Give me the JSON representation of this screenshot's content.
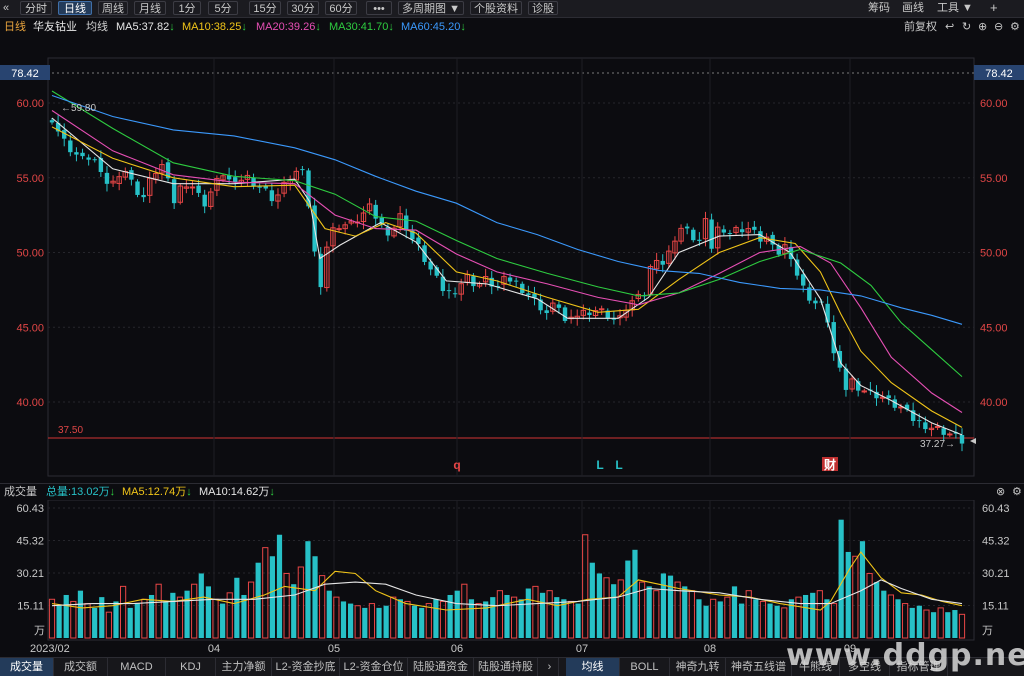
{
  "toolbar": {
    "back_icon": "double-chevron-left-icon",
    "items": [
      "分时",
      "日线",
      "周线",
      "月线",
      "1分",
      "5分",
      "15分",
      "30分",
      "60分",
      "•••",
      "多周期图 ▼",
      "个股资料",
      "诊股"
    ],
    "active": 1,
    "right": [
      "筹码",
      "画线",
      "工具 ▼",
      "+"
    ]
  },
  "header": {
    "period": "日线",
    "name": "华友钴业",
    "ma_label": "均线",
    "ma": [
      {
        "text": "MA5:37.82",
        "color": "#e6e6e6"
      },
      {
        "text": "MA10:38.25",
        "color": "#f0c419"
      },
      {
        "text": "MA20:39.26",
        "color": "#e64fb4"
      },
      {
        "text": "MA30:41.70",
        "color": "#2ecc40"
      },
      {
        "text": "MA60:45.20",
        "color": "#3b99fc"
      }
    ],
    "adjust": "前复权"
  },
  "price_axis": {
    "ticks": [
      "60.00",
      "55.00",
      "50.00",
      "45.00",
      "40.00"
    ],
    "tick_values": [
      60,
      55,
      50,
      45,
      40
    ],
    "top_marker": "78.42",
    "high_label": "59.80",
    "low_line": "37.50",
    "low_label": "37.27→"
  },
  "markers": [
    "q",
    "L",
    "L",
    "财"
  ],
  "volume": {
    "title": "成交量",
    "total": "总量:13.02万",
    "ma5": "MA5:12.74万",
    "ma10": "MA10:14.62万",
    "ticks": [
      "60.43",
      "45.32",
      "30.21",
      "15.11"
    ],
    "unit": "万",
    "max": 60.43
  },
  "dates": [
    "2023/02",
    "04",
    "05",
    "06",
    "07",
    "08",
    "09"
  ],
  "bottom_tabs": [
    "成交量",
    "成交额",
    "MACD",
    "KDJ",
    "主力净额",
    "L2-资金抄底",
    "L2-资金仓位",
    "陆股通资金",
    "陆股通持股"
  ],
  "indicator_tabs": [
    "均线",
    "BOLL",
    "神奇九转",
    "神奇五线谱",
    "牛熊线",
    "多空线",
    "指标管理"
  ],
  "watermark": "www.ddgp.net",
  "chart_data": {
    "type": "candlestick",
    "title": "华友钴业 日线",
    "xlabel": "",
    "ylabel": "",
    "ylim": [
      37.0,
      61.5
    ],
    "period_labels": [
      "2023/02",
      "04",
      "05",
      "06",
      "07",
      "08",
      "09"
    ],
    "close_path": [
      [
        0,
        59.0
      ],
      [
        10,
        57.6
      ],
      [
        20,
        56.8
      ],
      [
        30,
        56.2
      ],
      [
        40,
        56.5
      ],
      [
        50,
        54.8
      ],
      [
        60,
        54.6
      ],
      [
        70,
        55.8
      ],
      [
        80,
        54.5
      ],
      [
        90,
        53.6
      ],
      [
        100,
        55.3
      ],
      [
        110,
        55.9
      ],
      [
        120,
        53.3
      ],
      [
        130,
        54.8
      ],
      [
        140,
        54.4
      ],
      [
        150,
        53.2
      ],
      [
        160,
        54.4
      ],
      [
        170,
        55.4
      ],
      [
        180,
        54.3
      ],
      [
        190,
        55.2
      ],
      [
        200,
        54.7
      ],
      [
        210,
        54.2
      ],
      [
        220,
        53.5
      ],
      [
        230,
        54.5
      ],
      [
        240,
        55.4
      ],
      [
        250,
        55.2
      ],
      [
        260,
        49.8
      ],
      [
        265,
        47.6
      ],
      [
        270,
        50.1
      ],
      [
        278,
        51.5
      ],
      [
        285,
        51.9
      ],
      [
        295,
        51.8
      ],
      [
        305,
        52.4
      ],
      [
        315,
        53.0
      ],
      [
        325,
        51.8
      ],
      [
        335,
        51.3
      ],
      [
        345,
        52.5
      ],
      [
        355,
        51.0
      ],
      [
        365,
        50.1
      ],
      [
        370,
        49.3
      ],
      [
        380,
        48.2
      ],
      [
        390,
        47.2
      ],
      [
        400,
        47.6
      ],
      [
        410,
        48.4
      ],
      [
        420,
        47.8
      ],
      [
        430,
        48.2
      ],
      [
        440,
        47.6
      ],
      [
        450,
        48.3
      ],
      [
        460,
        47.9
      ],
      [
        470,
        47.3
      ],
      [
        480,
        46.6
      ],
      [
        490,
        45.9
      ],
      [
        500,
        46.8
      ],
      [
        505,
        45.6
      ],
      [
        510,
        45.1
      ],
      [
        520,
        45.9
      ],
      [
        530,
        46.1
      ],
      [
        540,
        46.2
      ],
      [
        550,
        45.8
      ],
      [
        560,
        45.3
      ],
      [
        570,
        46.6
      ],
      [
        580,
        46.9
      ],
      [
        590,
        47.5
      ],
      [
        595,
        51.2
      ],
      [
        600,
        48.8
      ],
      [
        610,
        49.9
      ],
      [
        620,
        51.7
      ],
      [
        630,
        51.3
      ],
      [
        640,
        50.6
      ],
      [
        645,
        52.7
      ],
      [
        650,
        49.9
      ],
      [
        660,
        51.9
      ],
      [
        670,
        51.3
      ],
      [
        680,
        51.6
      ],
      [
        690,
        51.6
      ],
      [
        700,
        50.9
      ],
      [
        710,
        51.0
      ],
      [
        715,
        49.6
      ],
      [
        720,
        50.1
      ],
      [
        728,
        50.6
      ],
      [
        735,
        48.8
      ],
      [
        745,
        47.3
      ],
      [
        755,
        46.6
      ],
      [
        765,
        46.3
      ],
      [
        775,
        42.5
      ],
      [
        780,
        41.9
      ],
      [
        785,
        40.9
      ],
      [
        790,
        41.5
      ],
      [
        800,
        40.9
      ],
      [
        810,
        40.6
      ],
      [
        820,
        40.4
      ],
      [
        830,
        39.9
      ],
      [
        840,
        39.6
      ],
      [
        850,
        38.9
      ],
      [
        860,
        38.6
      ],
      [
        870,
        38.3
      ],
      [
        880,
        38.1
      ],
      [
        890,
        37.8
      ],
      [
        900,
        37.4
      ]
    ],
    "series": [
      {
        "name": "MA5",
        "color": "#e6e6e6",
        "values": [
          [
            0,
            59.0
          ],
          [
            60,
            55.6
          ],
          [
            120,
            54.6
          ],
          [
            180,
            54.6
          ],
          [
            240,
            54.9
          ],
          [
            255,
            53.4
          ],
          [
            265,
            49.6
          ],
          [
            285,
            50.5
          ],
          [
            325,
            52.0
          ],
          [
            360,
            50.7
          ],
          [
            390,
            48.1
          ],
          [
            430,
            47.9
          ],
          [
            480,
            46.9
          ],
          [
            510,
            45.6
          ],
          [
            560,
            45.6
          ],
          [
            590,
            47.0
          ],
          [
            620,
            50.0
          ],
          [
            660,
            51.1
          ],
          [
            700,
            51.2
          ],
          [
            730,
            50.0
          ],
          [
            760,
            46.9
          ],
          [
            780,
            42.6
          ],
          [
            800,
            41.1
          ],
          [
            830,
            40.1
          ],
          [
            870,
            38.6
          ],
          [
            900,
            37.8
          ]
        ]
      },
      {
        "name": "MA10",
        "color": "#f0c419",
        "values": [
          [
            0,
            58.4
          ],
          [
            60,
            56.3
          ],
          [
            120,
            55.0
          ],
          [
            180,
            54.4
          ],
          [
            240,
            54.5
          ],
          [
            270,
            51.6
          ],
          [
            300,
            51.1
          ],
          [
            330,
            52.0
          ],
          [
            360,
            51.3
          ],
          [
            400,
            48.7
          ],
          [
            440,
            48.1
          ],
          [
            490,
            47.0
          ],
          [
            540,
            46.0
          ],
          [
            580,
            46.2
          ],
          [
            620,
            48.2
          ],
          [
            660,
            50.0
          ],
          [
            700,
            51.0
          ],
          [
            735,
            50.6
          ],
          [
            760,
            48.7
          ],
          [
            780,
            45.9
          ],
          [
            800,
            43.4
          ],
          [
            830,
            41.3
          ],
          [
            870,
            39.4
          ],
          [
            900,
            38.3
          ]
        ]
      },
      {
        "name": "MA20",
        "color": "#e64fb4",
        "values": [
          [
            0,
            59.5
          ],
          [
            60,
            56.8
          ],
          [
            120,
            55.2
          ],
          [
            180,
            54.7
          ],
          [
            240,
            54.6
          ],
          [
            280,
            52.5
          ],
          [
            320,
            51.6
          ],
          [
            360,
            51.5
          ],
          [
            400,
            49.9
          ],
          [
            440,
            48.7
          ],
          [
            490,
            47.9
          ],
          [
            540,
            47.0
          ],
          [
            580,
            46.5
          ],
          [
            620,
            47.3
          ],
          [
            660,
            48.6
          ],
          [
            700,
            50.0
          ],
          [
            740,
            50.4
          ],
          [
            770,
            49.3
          ],
          [
            800,
            46.3
          ],
          [
            830,
            43.0
          ],
          [
            870,
            40.6
          ],
          [
            900,
            39.3
          ]
        ]
      },
      {
        "name": "MA30",
        "color": "#2ecc40",
        "values": [
          [
            0,
            60.8
          ],
          [
            60,
            58.3
          ],
          [
            120,
            56.0
          ],
          [
            180,
            55.1
          ],
          [
            240,
            54.8
          ],
          [
            280,
            53.9
          ],
          [
            320,
            52.4
          ],
          [
            360,
            52.1
          ],
          [
            400,
            50.8
          ],
          [
            440,
            49.6
          ],
          [
            490,
            48.6
          ],
          [
            540,
            47.7
          ],
          [
            580,
            47.1
          ],
          [
            620,
            47.3
          ],
          [
            660,
            48.2
          ],
          [
            700,
            49.4
          ],
          [
            740,
            50.2
          ],
          [
            780,
            49.3
          ],
          [
            810,
            47.8
          ],
          [
            840,
            45.3
          ],
          [
            870,
            43.5
          ],
          [
            900,
            41.7
          ]
        ]
      },
      {
        "name": "MA60",
        "color": "#3b99fc",
        "values": [
          [
            0,
            60.5
          ],
          [
            60,
            59.1
          ],
          [
            120,
            58.2
          ],
          [
            180,
            57.8
          ],
          [
            240,
            57.0
          ],
          [
            280,
            56.2
          ],
          [
            320,
            55.1
          ],
          [
            360,
            54.1
          ],
          [
            400,
            53.3
          ],
          [
            440,
            52.0
          ],
          [
            480,
            51.2
          ],
          [
            520,
            50.2
          ],
          [
            560,
            49.4
          ],
          [
            600,
            48.8
          ],
          [
            640,
            48.6
          ],
          [
            680,
            48.0
          ],
          [
            720,
            47.6
          ],
          [
            760,
            47.5
          ],
          [
            800,
            47.1
          ],
          [
            840,
            46.3
          ],
          [
            870,
            45.8
          ],
          [
            900,
            45.2
          ]
        ]
      }
    ],
    "volume_ylim": [
      0,
      60.43
    ],
    "volume_ma5": [
      [
        0,
        16
      ],
      [
        30,
        14
      ],
      [
        60,
        15
      ],
      [
        90,
        18
      ],
      [
        120,
        17
      ],
      [
        150,
        19
      ],
      [
        180,
        16
      ],
      [
        210,
        20
      ],
      [
        230,
        24
      ],
      [
        260,
        22
      ],
      [
        280,
        31
      ],
      [
        300,
        30
      ],
      [
        320,
        22
      ],
      [
        350,
        16
      ],
      [
        390,
        13
      ],
      [
        430,
        14
      ],
      [
        470,
        18
      ],
      [
        500,
        15
      ],
      [
        530,
        18
      ],
      [
        560,
        19
      ],
      [
        580,
        27
      ],
      [
        600,
        25
      ],
      [
        620,
        23
      ],
      [
        660,
        20
      ],
      [
        690,
        19
      ],
      [
        720,
        16
      ],
      [
        760,
        13
      ],
      [
        770,
        17
      ],
      [
        790,
        33
      ],
      [
        800,
        40
      ],
      [
        820,
        28
      ],
      [
        840,
        21
      ],
      [
        860,
        20
      ],
      [
        880,
        17
      ],
      [
        900,
        15
      ]
    ],
    "volume_ma10": [
      [
        0,
        15
      ],
      [
        40,
        16
      ],
      [
        80,
        16
      ],
      [
        120,
        17
      ],
      [
        160,
        18
      ],
      [
        200,
        18
      ],
      [
        240,
        20
      ],
      [
        270,
        25
      ],
      [
        300,
        26
      ],
      [
        330,
        25
      ],
      [
        360,
        20
      ],
      [
        400,
        16
      ],
      [
        440,
        15
      ],
      [
        480,
        16
      ],
      [
        520,
        17
      ],
      [
        560,
        19
      ],
      [
        590,
        23
      ],
      [
        620,
        22
      ],
      [
        660,
        21
      ],
      [
        700,
        18
      ],
      [
        740,
        16
      ],
      [
        770,
        16
      ],
      [
        800,
        22
      ],
      [
        820,
        27
      ],
      [
        840,
        23
      ],
      [
        870,
        18
      ],
      [
        900,
        16
      ]
    ],
    "volume_hint": [
      18,
      15,
      20,
      17,
      22,
      16,
      14,
      19,
      12,
      17,
      24,
      14,
      16,
      18,
      20,
      25,
      17,
      21,
      19,
      22,
      25,
      30,
      24,
      18,
      16,
      21,
      28,
      20,
      26,
      35,
      42,
      38,
      48,
      30,
      25,
      33,
      45,
      38,
      29,
      22,
      19,
      17,
      16,
      15,
      14,
      16,
      14,
      15,
      19,
      18,
      17,
      15,
      14,
      16,
      18,
      17,
      20,
      22,
      25,
      18,
      16,
      17,
      19,
      22,
      20,
      19,
      18,
      23,
      24,
      21,
      22,
      19,
      18,
      17,
      16,
      48,
      35,
      30,
      28,
      25,
      27,
      36,
      41,
      26,
      24,
      22,
      30,
      29,
      26,
      24,
      22,
      18,
      15,
      18,
      17,
      19,
      24,
      16,
      22,
      18,
      17,
      16,
      15,
      14,
      18,
      19,
      20,
      21,
      22,
      18,
      16,
      55,
      40,
      38,
      45,
      30,
      26,
      22,
      20,
      18,
      16,
      14,
      15,
      13,
      12,
      14,
      12,
      13,
      11
    ]
  }
}
